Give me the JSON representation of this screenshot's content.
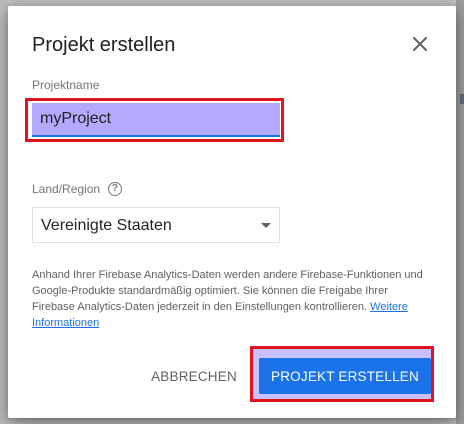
{
  "dialog": {
    "title": "Projekt erstellen",
    "close_icon": "close-icon"
  },
  "project_name": {
    "label": "Projektname",
    "value": "myProject"
  },
  "region": {
    "label": "Land/Region",
    "help_icon": "help-circle-icon",
    "help_glyph": "?",
    "selected": "Vereinigte Staaten",
    "caret_icon": "chevron-down-icon"
  },
  "info": {
    "text": "Anhand Ihrer Firebase Analytics-Daten werden andere Firebase-Funktionen und Google-Produkte standardmäßig optimiert. Sie können die Freigabe Ihrer Firebase Analytics-Daten jederzeit in den Einstellungen kontrollieren.",
    "link": "Weitere Informationen"
  },
  "actions": {
    "cancel": "ABBRECHEN",
    "create": "PROJEKT ERSTELLEN"
  },
  "colors": {
    "accent": "#1a73e8",
    "highlight_border": "#e0141e",
    "input_highlight": "#b3aaff"
  }
}
